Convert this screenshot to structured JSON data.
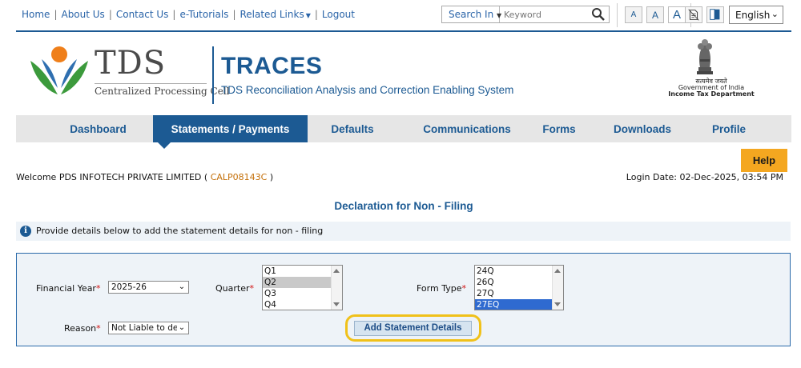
{
  "top_links": {
    "home": "Home",
    "about": "About Us",
    "contact": "Contact Us",
    "tutorials": "e-Tutorials",
    "related": "Related Links",
    "logout": "Logout"
  },
  "search": {
    "label": "Search In",
    "placeholder": "Keyword"
  },
  "font_size_buttons": [
    "A",
    "A",
    "A"
  ],
  "language": "English",
  "header": {
    "logo_text": "TDS",
    "logo_subtext": "Centralized Processing Cell",
    "title": "TRACES",
    "subtitle": "TDS Reconciliation Analysis and Correction Enabling System",
    "motto": "सत्यमेव जयते",
    "gov": "Government of India",
    "dept": "Income Tax Department"
  },
  "nav": {
    "items": [
      "Dashboard",
      "Statements / Payments",
      "Defaults",
      "Communications",
      "Forms",
      "Downloads",
      "Profile"
    ],
    "active_index": 1
  },
  "help_label": "Help",
  "welcome": {
    "prefix": "Welcome PDS INFOTECH PRIVATE LIMITED (",
    "user_id": "CALP08143C",
    "suffix": ")"
  },
  "login_date": "Login Date: 02-Dec-2025, 03:54 PM",
  "page_title": "Declaration for Non - Filing",
  "info_text": "Provide details below to add the statement details for non - filing",
  "form": {
    "financial_year_label": "Financial Year",
    "financial_year_value": "2025-26",
    "quarter_label": "Quarter",
    "quarter_options": [
      "Q1",
      "Q2",
      "Q3",
      "Q4"
    ],
    "quarter_selected": "Q2",
    "form_type_label": "Form Type",
    "form_type_options": [
      "24Q",
      "26Q",
      "27Q",
      "27EQ"
    ],
    "form_type_selected": "27EQ",
    "reason_label": "Reason",
    "reason_value": "Not Liable to dec",
    "add_button": "Add Statement Details"
  },
  "colors": {
    "primary_blue": "#1c5a93",
    "nav_bg": "#e6e6e6",
    "help_orange": "#f4a720",
    "highlight_yellow": "#f0c11a",
    "user_id_orange": "#c4700a",
    "required_red": "#d01010"
  },
  "icons": [
    "search-icon",
    "pdf-document-icon",
    "contrast-icon",
    "info-icon",
    "chevron-down-icon",
    "national-emblem-icon",
    "tds-logo-icon"
  ]
}
